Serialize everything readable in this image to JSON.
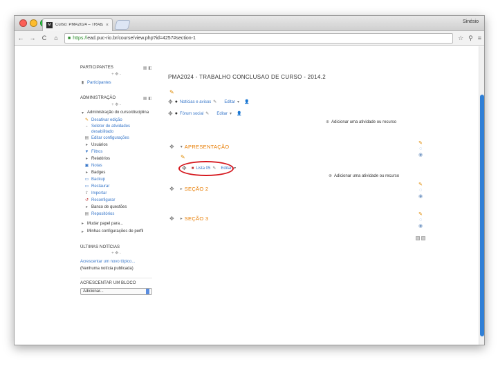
{
  "browser": {
    "tab_title": "Curso: PMA2024 – TRABA",
    "tab_favicon": "M",
    "tab_close": "×",
    "user_name": "Sinésio",
    "url_scheme": "https://",
    "url_rest": "ead.puc-rio.br/course/view.php?id=4257#section-1",
    "nav": {
      "back": "←",
      "forward": "→",
      "reload": "C",
      "home": "⌂"
    },
    "toolbar_icons": {
      "star": "☆",
      "search": "🔍",
      "menu": "≡"
    }
  },
  "left": {
    "participants": {
      "title": "PARTICIPANTES",
      "controls": "▦ ◧",
      "move": "+ ✥ -",
      "items": [
        {
          "label": "Participantes",
          "icon": "👤"
        }
      ]
    },
    "admin": {
      "title": "ADMINISTRAÇÃO",
      "controls": "▦ ◧",
      "move": "+ ✥ -",
      "root": "Administração do curso/disciplina",
      "items": [
        {
          "label": "Desativar edição",
          "icon": "✎"
        },
        {
          "label": "Seletor de atividades desabilitado",
          "icon": "▫"
        },
        {
          "label": "Editar configurações",
          "icon": "▤"
        },
        {
          "label": "Usuários",
          "icon": "▸"
        },
        {
          "label": "Filtros",
          "icon": "▼"
        },
        {
          "label": "Relatórios",
          "icon": "▸"
        },
        {
          "label": "Notas",
          "icon": "▣"
        },
        {
          "label": "Badges",
          "icon": "▸"
        },
        {
          "label": "Backup",
          "icon": "▭"
        },
        {
          "label": "Restaurar",
          "icon": "▭"
        },
        {
          "label": "Importar",
          "icon": "⇪"
        },
        {
          "label": "Reconfigurar",
          "icon": "↺"
        },
        {
          "label": "Banco de questões",
          "icon": "▸"
        },
        {
          "label": "Repositórios",
          "icon": "▤"
        }
      ],
      "switch_role": "Mudar papel para...",
      "my_profile": "Minhas configurações de perfil"
    },
    "news": {
      "title": "ÚLTIMAS NOTÍCIAS",
      "move": "+ ✥ -",
      "add_topic": "Acrescentar um novo tópico...",
      "empty": "(Nenhuma notícia publicada)"
    },
    "blog": {
      "title": "ACRESCENTAR UM BLOCO",
      "select_value": "Adicionar..."
    }
  },
  "main": {
    "course_title": "PMA2024 - TRABALHO CONCLUSAO DE CURSO - 2014.2",
    "activities_top": [
      {
        "label": "Notícias e avisos",
        "edit": "Editar"
      },
      {
        "label": "Fórum social",
        "edit": "Editar"
      }
    ],
    "add_activity": "Adicionar uma atividade ou recurso",
    "sections": [
      {
        "title": "APRESENTAÇÃO"
      },
      {
        "title": "SEÇÃO 2"
      },
      {
        "title": "SEÇÃO 3"
      }
    ],
    "section1_activity": {
      "label": "Lista 05",
      "edit": "Editar"
    }
  }
}
